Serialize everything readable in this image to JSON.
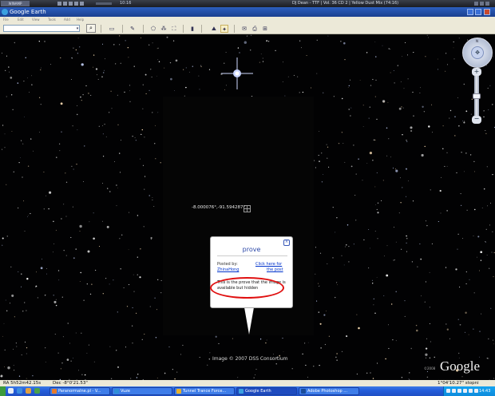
{
  "winamp": {
    "logo": "WINAMP",
    "time": "10:16",
    "track": "DJ Dean - TTF | Vol. 36 CD 2 | Yellow Dust Mix (74:16)"
  },
  "window": {
    "title": "Google Earth"
  },
  "menu": [
    "File",
    "Edit",
    "View",
    "Tools",
    "Add",
    "Help"
  ],
  "search": {
    "value": "",
    "placeholder": ""
  },
  "overlay": {
    "coordinates": "-8.000076°,-91.594287°",
    "credit": "Image © 2007 DSS Consortium"
  },
  "popup": {
    "title": "prove",
    "posted_by": "Posted by:",
    "author": "ZhinaHong",
    "link_line1": "Click here for",
    "link_line2": "the post",
    "body": "This is the prove that the image is available but hidden"
  },
  "branding": {
    "logo": "Google",
    "small": "©2008"
  },
  "navigation": {
    "north": "N"
  },
  "status": {
    "ra": "RA  5h52m42.15s",
    "dec": "Dec  -8°0'21.53\"",
    "fov": "1°04'10.27\" stopni"
  },
  "taskbar": {
    "tasks": [
      {
        "label": "Paranormalne.pl - V...",
        "color": "#e87a2a"
      },
      {
        "label": "Vuze",
        "color": "#2f8fd8"
      },
      {
        "label": "Tunnel Trance Force...",
        "color": "#e8b02a"
      },
      {
        "label": "Google Earth",
        "color": "#3aa0e0"
      },
      {
        "label": "Adobe Photoshop ...",
        "color": "#1b4c9a"
      }
    ],
    "clock": "14:43"
  }
}
